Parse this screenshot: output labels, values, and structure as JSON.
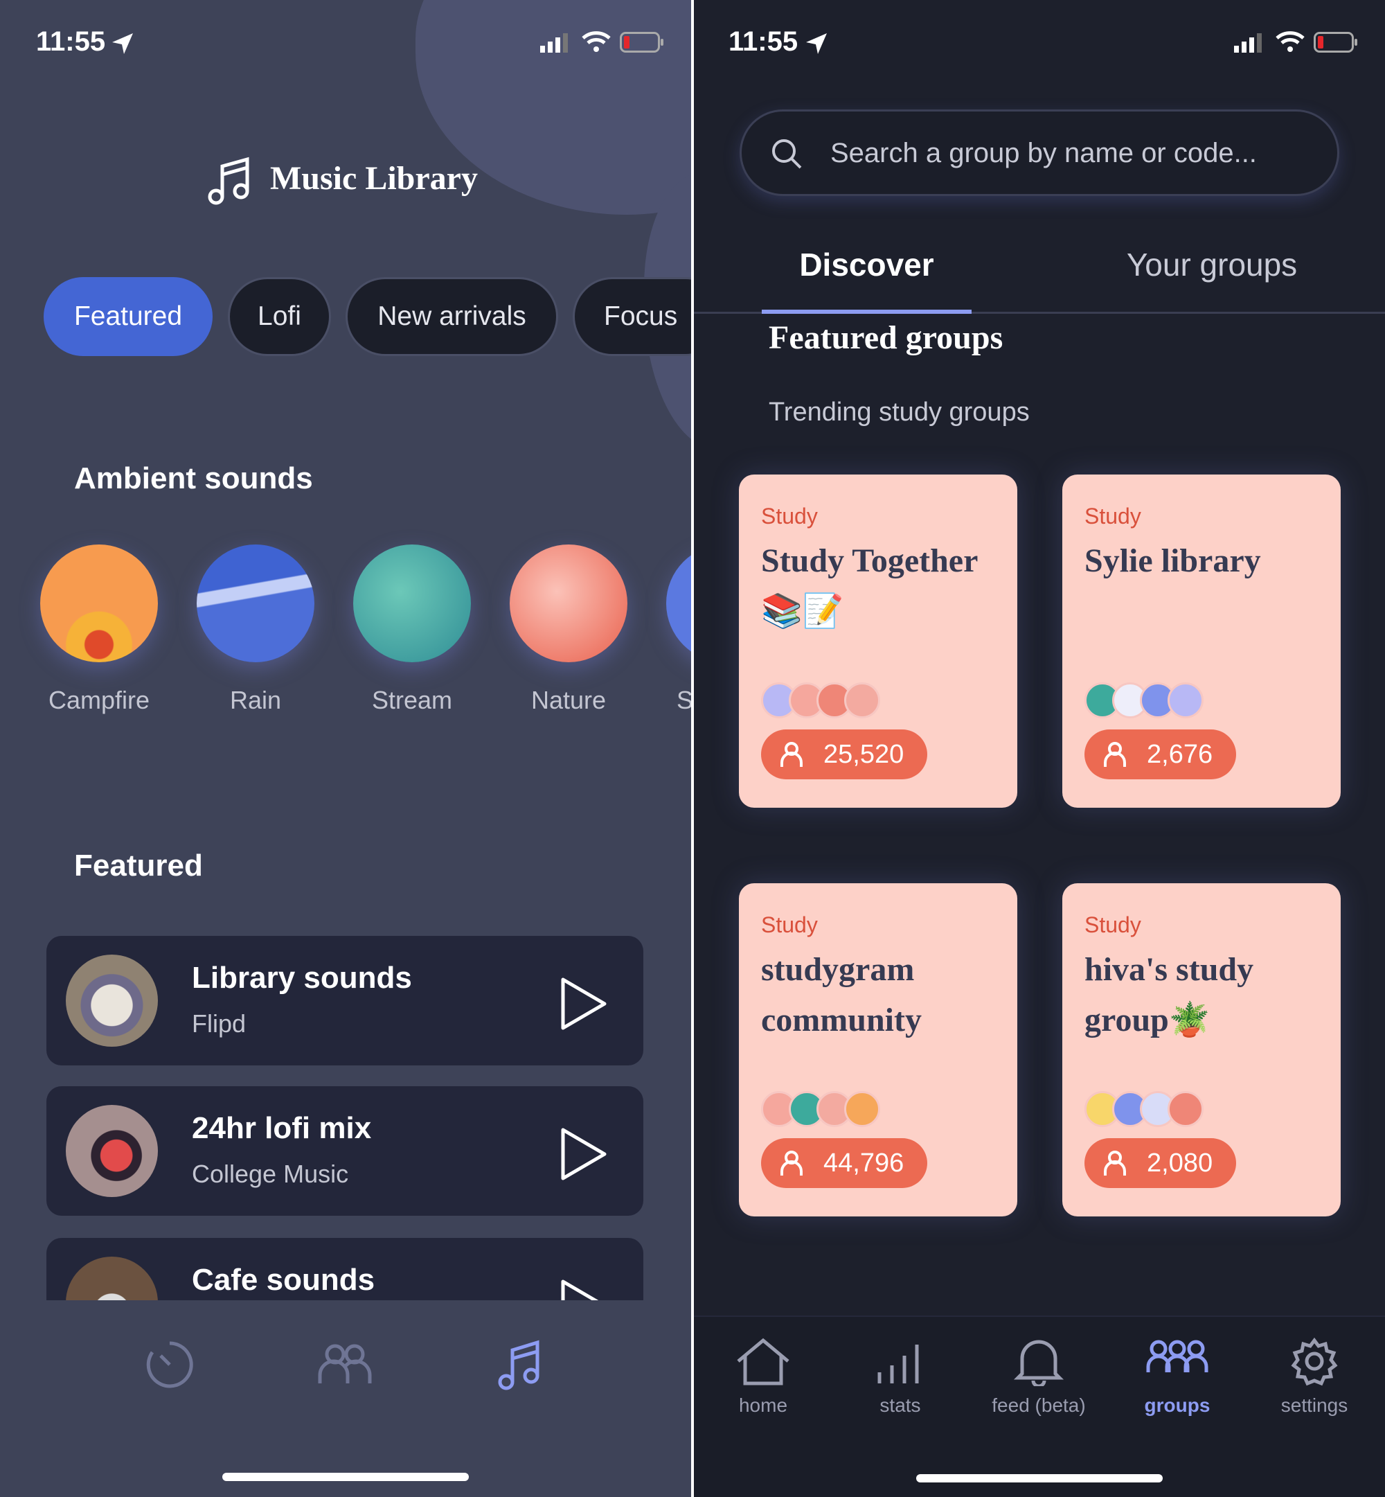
{
  "left": {
    "status": {
      "time": "11:55"
    },
    "title": "Music Library",
    "chips": [
      {
        "label": "Featured",
        "active": true
      },
      {
        "label": "Lofi",
        "active": false
      },
      {
        "label": "New arrivals",
        "active": false
      },
      {
        "label": "Focus",
        "active": false
      }
    ],
    "ambient_heading": "Ambient sounds",
    "ambient": [
      {
        "label": "Campfire"
      },
      {
        "label": "Rain"
      },
      {
        "label": "Stream"
      },
      {
        "label": "Nature"
      },
      {
        "label": "S"
      }
    ],
    "featured_heading": "Featured",
    "tracks": [
      {
        "title": "Library sounds",
        "subtitle": "Flipd"
      },
      {
        "title": "24hr lofi mix",
        "subtitle": "College Music"
      },
      {
        "title": "Cafe sounds",
        "subtitle": ""
      }
    ],
    "nav": [
      {
        "icon": "timer-icon"
      },
      {
        "icon": "groups-icon"
      },
      {
        "icon": "music-note-icon",
        "active": true
      }
    ]
  },
  "right": {
    "status": {
      "time": "11:55"
    },
    "search": {
      "placeholder": "Search a group by name or code..."
    },
    "tabs": [
      {
        "label": "Discover",
        "active": true
      },
      {
        "label": "Your groups",
        "active": false
      }
    ],
    "section_title": "Featured groups",
    "section_subtitle": "Trending study groups",
    "groups": [
      {
        "category": "Study",
        "name": "Study Together📚📝",
        "members": "25,520"
      },
      {
        "category": "Study",
        "name": "Sylie library",
        "members": "2,676"
      },
      {
        "category": "Study",
        "name": "studygram community",
        "members": "44,796"
      },
      {
        "category": "Study",
        "name": "hiva's study group🪴",
        "members": "2,080"
      }
    ],
    "nav": [
      {
        "label": "home",
        "icon": "home-icon"
      },
      {
        "label": "stats",
        "icon": "stats-icon"
      },
      {
        "label": "feed (beta)",
        "icon": "bell-icon"
      },
      {
        "label": "groups",
        "icon": "groups-icon",
        "active": true
      },
      {
        "label": "settings",
        "icon": "gear-icon"
      }
    ]
  },
  "colors": {
    "accent": "#4466d4",
    "card": "#fdd1c8",
    "count_pill": "#ec6a52",
    "active_nav": "#8d9cf2"
  }
}
